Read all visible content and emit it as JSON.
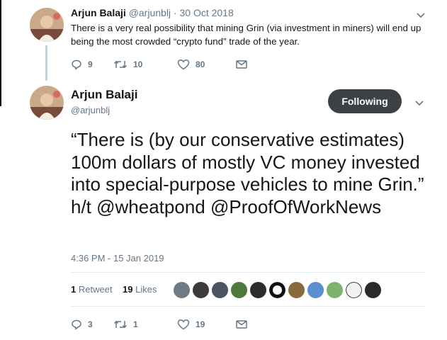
{
  "tweet1": {
    "name": "Arjun Balaji",
    "meta": "@arjunblj · 30 Oct 2018",
    "text": "There is a very real possibility that mining Grin (via investment in miners) will end up being the most crowded “crypto fund” trade of the year.",
    "replies": "9",
    "retweets": "10",
    "likes": "80"
  },
  "tweet2": {
    "name": "Arjun Balaji",
    "handle": "@arjunblj",
    "follow_label": "Following",
    "text": "“There is (by our conservative estimates) 100m dollars of mostly VC money invested into special-purpose vehicles to mine Grin.” h/t @wheatpond @ProofOfWorkNews",
    "timestamp": "4:36 PM - 15 Jan 2019",
    "retweet_count": "1",
    "retweet_label": "Retweet",
    "like_count": "19",
    "like_label": "Likes",
    "replies": "3",
    "retweets": "1",
    "likes": "19"
  },
  "icons": {
    "reply": "reply-icon",
    "retweet": "retweet-icon",
    "like": "heart-icon",
    "dm": "envelope-icon",
    "caret": "chevron-down-icon"
  },
  "colors": {
    "text": "#14171a",
    "secondary": "#657786",
    "follow_button": "#3c4146",
    "divider": "#e6ecf0"
  }
}
